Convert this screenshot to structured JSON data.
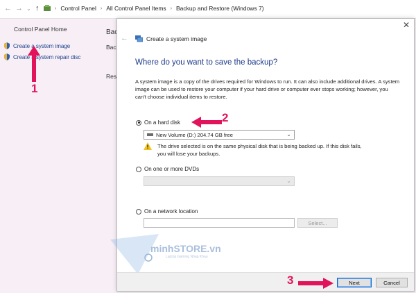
{
  "address_bar": {
    "breadcrumbs": [
      "Control Panel",
      "All Control Panel Items",
      "Backup and Restore (Windows 7)"
    ]
  },
  "left_panel": {
    "home": "Control Panel Home",
    "links": [
      {
        "label": "Create a system image",
        "icon": "shield-icon"
      },
      {
        "label": "Create a system repair disc",
        "icon": "shield-icon"
      }
    ]
  },
  "background_peek": {
    "heading": "Bac",
    "item1": "Back",
    "item2": "Rest"
  },
  "dialog": {
    "window_title": "Create a system image",
    "heading": "Where do you want to save the backup?",
    "description": "A system image is a copy of the drives required for Windows to run. It can also include additional drives. A system image can be used to restore your computer if your hard drive or computer ever stops working; however, you can't choose individual items to restore.",
    "options": {
      "hard_disk": {
        "label": "On a hard disk",
        "selected": true,
        "selected_drive": "New Volume (D:)  204.74 GB free"
      },
      "dvds": {
        "label": "On one or more DVDs",
        "selected": false
      },
      "network": {
        "label": "On a network location",
        "selected": false,
        "select_button": "Select..."
      }
    },
    "warning": "The drive selected is on the same physical disk that is being backed up. If this disk fails, you will lose your backups.",
    "buttons": {
      "next": "Next",
      "cancel": "Cancel"
    }
  },
  "annotations": {
    "step1": "1",
    "step2": "2",
    "step3": "3"
  },
  "watermark": {
    "brand": "minhSTORE.vn",
    "tagline": "Laptop Gaming Nhap Khau"
  },
  "colors": {
    "accent": "#e0135b",
    "heading_blue": "#1c3a8a",
    "link_blue": "#1a3e8c"
  }
}
